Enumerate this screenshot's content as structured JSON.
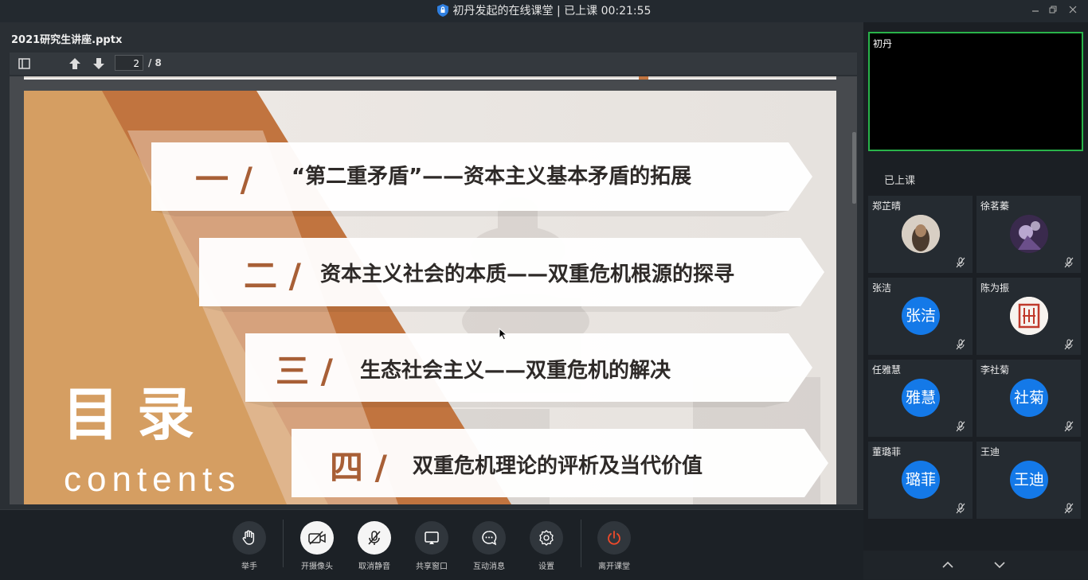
{
  "window": {
    "title": "初丹发起的在线课堂 | 已上课 00:21:55",
    "controls": [
      "minimize",
      "restore",
      "close"
    ]
  },
  "document": {
    "filename": "2021研究生讲座.pptx",
    "current_page": "2",
    "total_pages": "/ 8"
  },
  "slide": {
    "title": "目录",
    "subtitle": "contents",
    "items": [
      {
        "num": "一 /",
        "text": "“第二重矛盾”——资本主义基本矛盾的拓展"
      },
      {
        "num": "二 /",
        "text": "资本主义社会的本质——双重危机根源的探寻"
      },
      {
        "num": "三 /",
        "text": "生态社会主义——双重危机的解决"
      },
      {
        "num": "四 /",
        "text": "双重危机理论的评析及当代价值"
      }
    ],
    "colors": {
      "accent": "#c1743f",
      "light_accent": "#d8a56b",
      "number": "#a85f36"
    }
  },
  "controls": [
    {
      "label": "举手",
      "icon": "hand-icon"
    },
    {
      "label": "开摄像头",
      "icon": "camera-off-icon"
    },
    {
      "label": "取消静音",
      "icon": "mic-off-icon"
    },
    {
      "label": "共享窗口",
      "icon": "share-screen-icon"
    },
    {
      "label": "互动消息",
      "icon": "chat-icon"
    },
    {
      "label": "设置",
      "icon": "gear-icon"
    },
    {
      "label": "离开课堂",
      "icon": "power-icon"
    }
  ],
  "teacher": {
    "name": "初丹"
  },
  "class_status": "已上课",
  "participants": [
    {
      "name": "郑芷晴",
      "avatar_text": "",
      "avatar_type": "photo"
    },
    {
      "name": "徐茗蓁",
      "avatar_text": "",
      "avatar_type": "photo"
    },
    {
      "name": "张洁",
      "avatar_text": "张洁",
      "avatar_type": "text"
    },
    {
      "name": "陈为振",
      "avatar_text": "",
      "avatar_type": "seal"
    },
    {
      "name": "任雅慧",
      "avatar_text": "雅慧",
      "avatar_type": "text"
    },
    {
      "name": "李社菊",
      "avatar_text": "社菊",
      "avatar_type": "text"
    },
    {
      "name": "董璐菲",
      "avatar_text": "璐菲",
      "avatar_type": "text"
    },
    {
      "name": "王迪",
      "avatar_text": "王迪",
      "avatar_type": "text"
    }
  ]
}
